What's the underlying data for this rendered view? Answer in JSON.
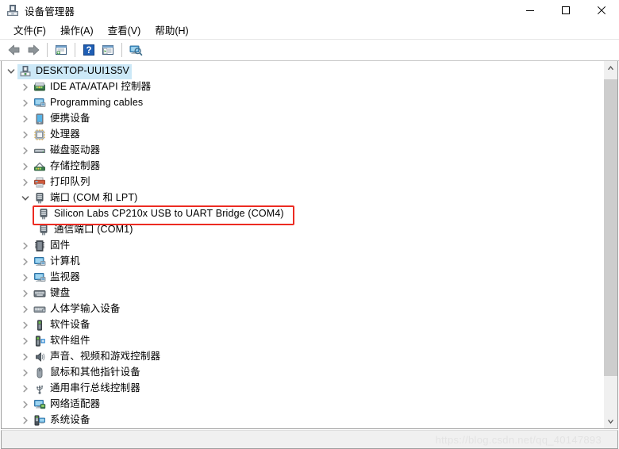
{
  "window": {
    "title": "设备管理器",
    "icon": "device-manager-icon",
    "minimize_label": "—",
    "maximize_label": "□",
    "close_label": "✕"
  },
  "menubar": {
    "items": [
      {
        "label": "文件(F)",
        "text": "文件(",
        "mnemonic": "F",
        "close": ")"
      },
      {
        "label": "操作(A)",
        "text": "操作(",
        "mnemonic": "A",
        "close": ")"
      },
      {
        "label": "查看(V)",
        "text": "查看(",
        "mnemonic": "V",
        "close": ")"
      },
      {
        "label": "帮助(H)",
        "text": "帮助(",
        "mnemonic": "H",
        "close": ")"
      }
    ]
  },
  "toolbar": {
    "items": [
      {
        "name": "back-arrow-icon",
        "type": "button"
      },
      {
        "name": "forward-arrow-icon",
        "type": "button"
      },
      {
        "name": "separator-1",
        "type": "separator"
      },
      {
        "name": "properties-icon",
        "type": "button"
      },
      {
        "name": "separator-2",
        "type": "separator"
      },
      {
        "name": "help-icon",
        "type": "button"
      },
      {
        "name": "update-driver-icon",
        "type": "button"
      },
      {
        "name": "separator-3",
        "type": "separator"
      },
      {
        "name": "scan-hardware-changes-icon",
        "type": "button"
      }
    ]
  },
  "tree": {
    "root": {
      "label": "DESKTOP-UUI1S5V",
      "icon": "computer-icon",
      "expanded": true,
      "selected": true
    },
    "nodes": [
      {
        "label": "IDE ATA/ATAPI 控制器",
        "icon": "ide-controller-icon",
        "level": 1,
        "expanded": false
      },
      {
        "label": "Programming cables",
        "icon": "monitor-icon",
        "level": 1,
        "expanded": false
      },
      {
        "label": "便携设备",
        "icon": "portable-device-icon",
        "level": 1,
        "expanded": false
      },
      {
        "label": "处理器",
        "icon": "processor-icon",
        "level": 1,
        "expanded": false
      },
      {
        "label": "磁盘驱动器",
        "icon": "disk-drive-icon",
        "level": 1,
        "expanded": false
      },
      {
        "label": "存储控制器",
        "icon": "storage-controller-icon",
        "level": 1,
        "expanded": false
      },
      {
        "label": "打印队列",
        "icon": "printer-icon",
        "level": 1,
        "expanded": false
      },
      {
        "label": "端口 (COM 和 LPT)",
        "icon": "port-icon",
        "level": 1,
        "expanded": true
      },
      {
        "label": "Silicon Labs CP210x USB to UART Bridge (COM4)",
        "icon": "port-icon",
        "level": 2,
        "highlighted": true
      },
      {
        "label": "通信端口 (COM1)",
        "icon": "port-icon",
        "level": 2
      },
      {
        "label": "固件",
        "icon": "firmware-icon",
        "level": 1,
        "expanded": false
      },
      {
        "label": "计算机",
        "icon": "monitor-icon",
        "level": 1,
        "expanded": false
      },
      {
        "label": "监视器",
        "icon": "monitor-icon",
        "level": 1,
        "expanded": false
      },
      {
        "label": "键盘",
        "icon": "keyboard-icon",
        "level": 1,
        "expanded": false
      },
      {
        "label": "人体学输入设备",
        "icon": "hid-icon",
        "level": 1,
        "expanded": false
      },
      {
        "label": "软件设备",
        "icon": "software-device-icon",
        "level": 1,
        "expanded": false
      },
      {
        "label": "软件组件",
        "icon": "software-component-icon",
        "level": 1,
        "expanded": false
      },
      {
        "label": "声音、视频和游戏控制器",
        "icon": "sound-icon",
        "level": 1,
        "expanded": false
      },
      {
        "label": "鼠标和其他指针设备",
        "icon": "mouse-icon",
        "level": 1,
        "expanded": false
      },
      {
        "label": "通用串行总线控制器",
        "icon": "usb-icon",
        "level": 1,
        "expanded": false
      },
      {
        "label": "网络适配器",
        "icon": "network-adapter-icon",
        "level": 1,
        "expanded": false
      },
      {
        "label": "系统设备",
        "icon": "system-device-icon",
        "level": 1,
        "expanded": false
      }
    ]
  },
  "annotation": {
    "highlight_color": "#ec2b22",
    "target_label": "Silicon Labs CP210x USB to UART Bridge (COM4)"
  },
  "scrollbar": {
    "up_arrow": "▲",
    "down_arrow": "▼"
  },
  "watermark": {
    "text": "https://blog.csdn.net/qq_40147893"
  },
  "colors": {
    "selection": "#cce8f7",
    "annotation": "#ec2b22",
    "chrome": "#f0f0f0"
  }
}
